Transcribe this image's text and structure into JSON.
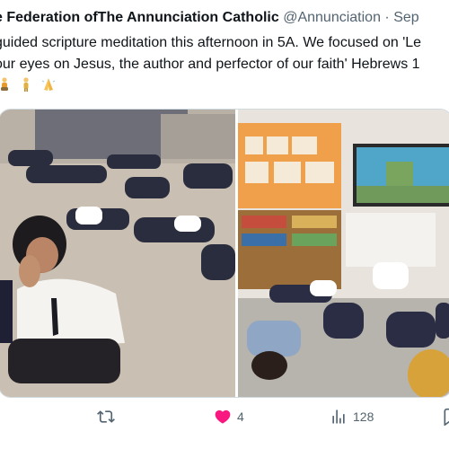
{
  "tweet": {
    "author_name": "e Federation ofThe Annunciation Catholic",
    "handle": "@Annunciation",
    "separator": "·",
    "date": "Sep",
    "text_lines": [
      "guided scripture meditation this afternoon in 5A. We focused on 'Le",
      "our eyes on Jesus, the author and perfector of our faith' Hebrews 1"
    ],
    "emojis": [
      "person-kneeling-emoji",
      "person-standing-emoji",
      "folded-hands-emoji"
    ]
  },
  "actions": {
    "reply_count": "",
    "like_count": "4",
    "views_count": "128"
  },
  "colors": {
    "text": "#0f1419",
    "secondary": "#536471",
    "like": "#f91880",
    "border": "#cfd9de"
  }
}
